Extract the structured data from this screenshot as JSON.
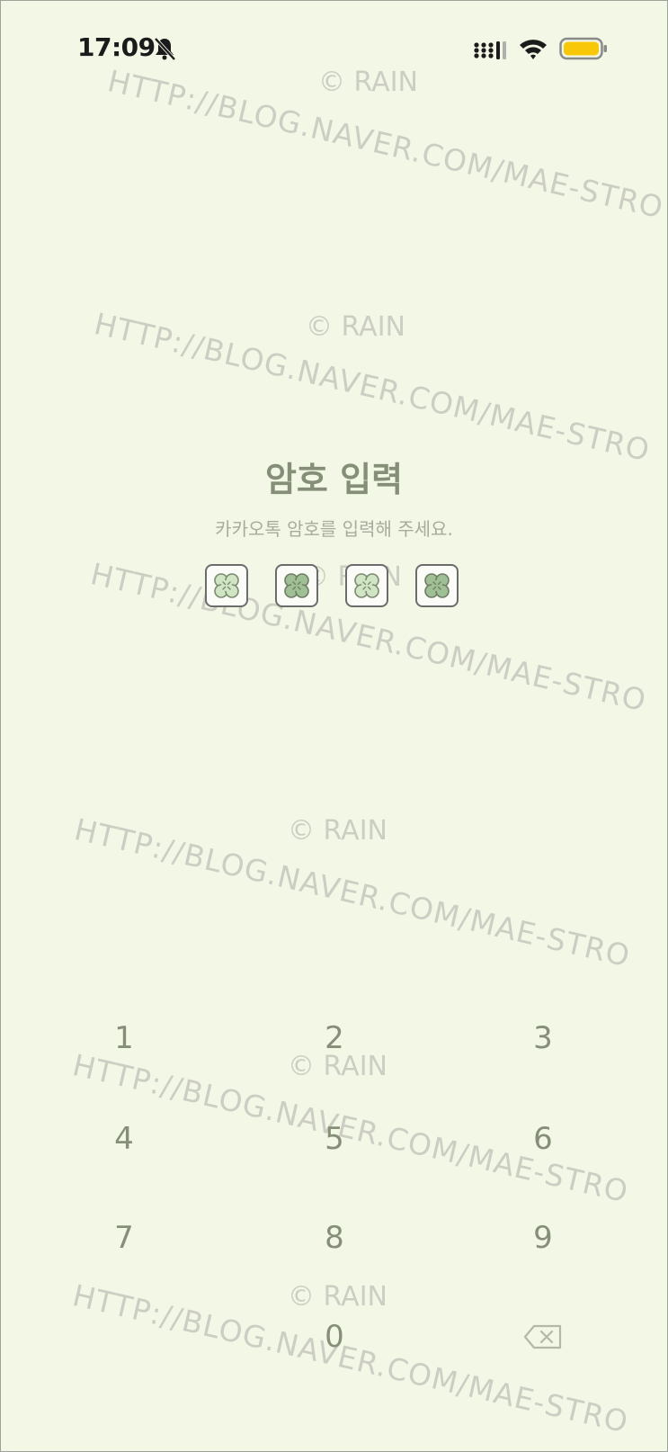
{
  "status_bar": {
    "time": "17:09"
  },
  "passcode": {
    "title": "암호 입력",
    "subtitle": "카카오톡 암호를 입력해 주세요.",
    "slots": [
      {
        "icon": "clover-icon",
        "tone": "light"
      },
      {
        "icon": "clover-icon",
        "tone": "dark"
      },
      {
        "icon": "clover-icon",
        "tone": "light"
      },
      {
        "icon": "clover-icon",
        "tone": "dark"
      }
    ]
  },
  "keypad": {
    "keys": [
      "1",
      "2",
      "3",
      "4",
      "5",
      "6",
      "7",
      "8",
      "9",
      "",
      "0",
      "backspace"
    ]
  },
  "watermark": {
    "copyright": "© RAIN",
    "url": "HTTP://BLOG.NAVER.COM/MAE-STRO"
  },
  "colors": {
    "background": "#f3f7e6",
    "text": "#858f78",
    "battery": "#f8c808",
    "clover_light": "#cfe5c4",
    "clover_dark": "#9fbf95"
  }
}
